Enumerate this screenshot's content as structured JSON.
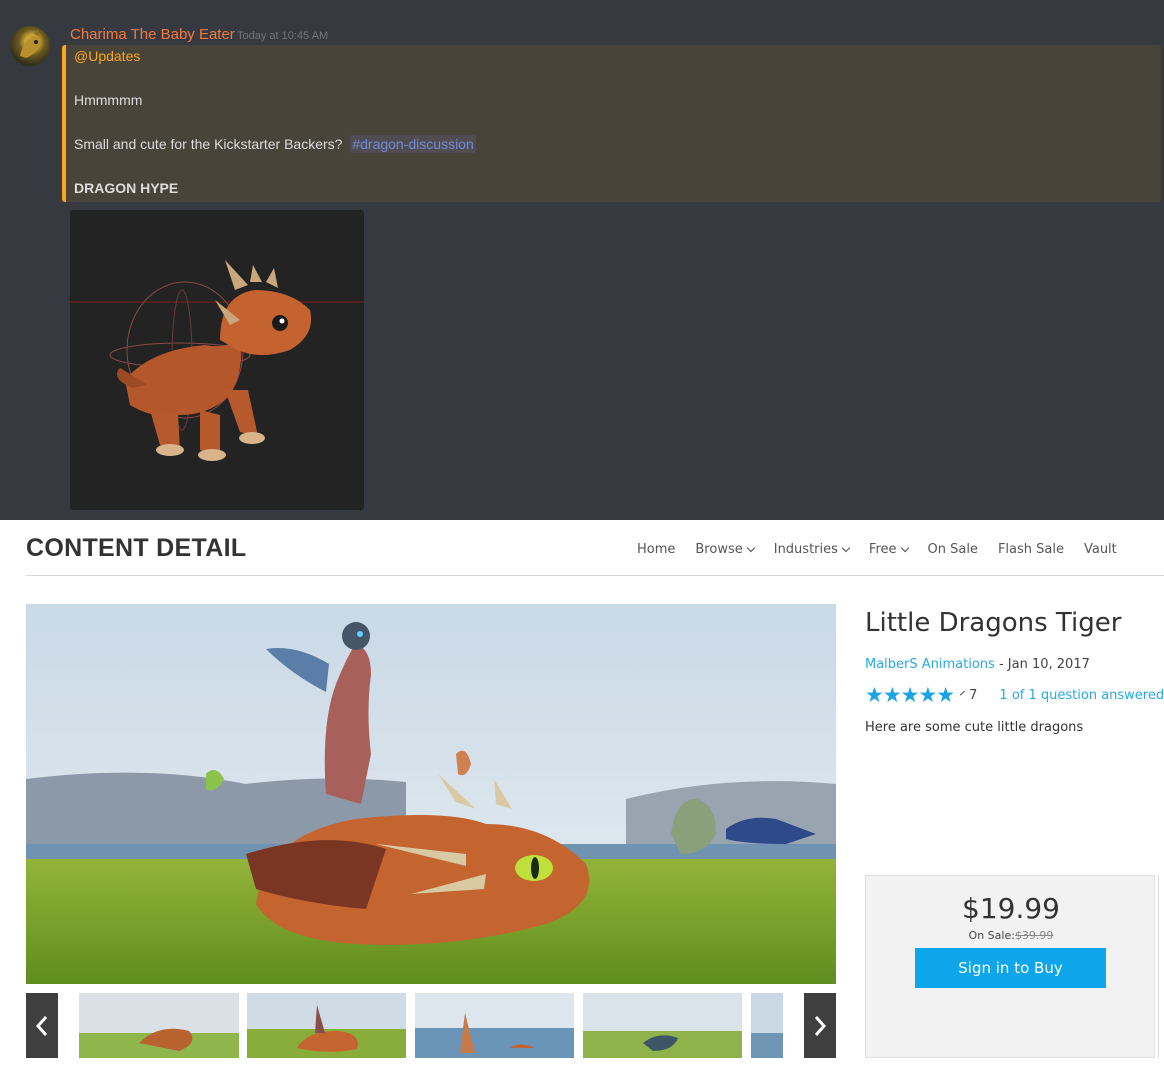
{
  "discord": {
    "author": "Charima The Baby Eater",
    "timestamp": "Today at 10:45 AM",
    "embed": {
      "mention": "@Updates",
      "line2": "Hmmmmm",
      "line3": "Small and cute for the Kickstarter Backers?",
      "channel_tag": "#dragon-discussion",
      "heading": "DRAGON HYPE",
      "accent_color": "#faa61a"
    },
    "author_color": "#f47b3d"
  },
  "store": {
    "page_title": "CONTENT DETAIL",
    "nav": [
      {
        "label": "Home",
        "dropdown": false
      },
      {
        "label": "Browse",
        "dropdown": true
      },
      {
        "label": "Industries",
        "dropdown": true
      },
      {
        "label": "Free",
        "dropdown": true
      },
      {
        "label": "On Sale",
        "dropdown": false
      },
      {
        "label": "Flash Sale",
        "dropdown": false
      },
      {
        "label": "Vault",
        "dropdown": false
      }
    ],
    "product": {
      "title": "Little Dragons Tiger",
      "publisher": "MalberS Animations",
      "date_sep": " - ",
      "date": "Jan 10, 2017",
      "stars": 5,
      "stars_glyphs": "★★★★★",
      "rating_count": "7",
      "qa": "1 of 1 question answered",
      "description": "Here are some cute little dragons"
    },
    "purchase": {
      "price": "$19.99",
      "sale_label": "On Sale:",
      "old_price": "$39.99",
      "button": "Sign in to Buy",
      "button_color": "#0ea5ea"
    },
    "gallery": {
      "prev_icon": "chevron-left-icon",
      "next_icon": "chevron-right-icon",
      "thumbnail_count_visible": 5
    }
  }
}
